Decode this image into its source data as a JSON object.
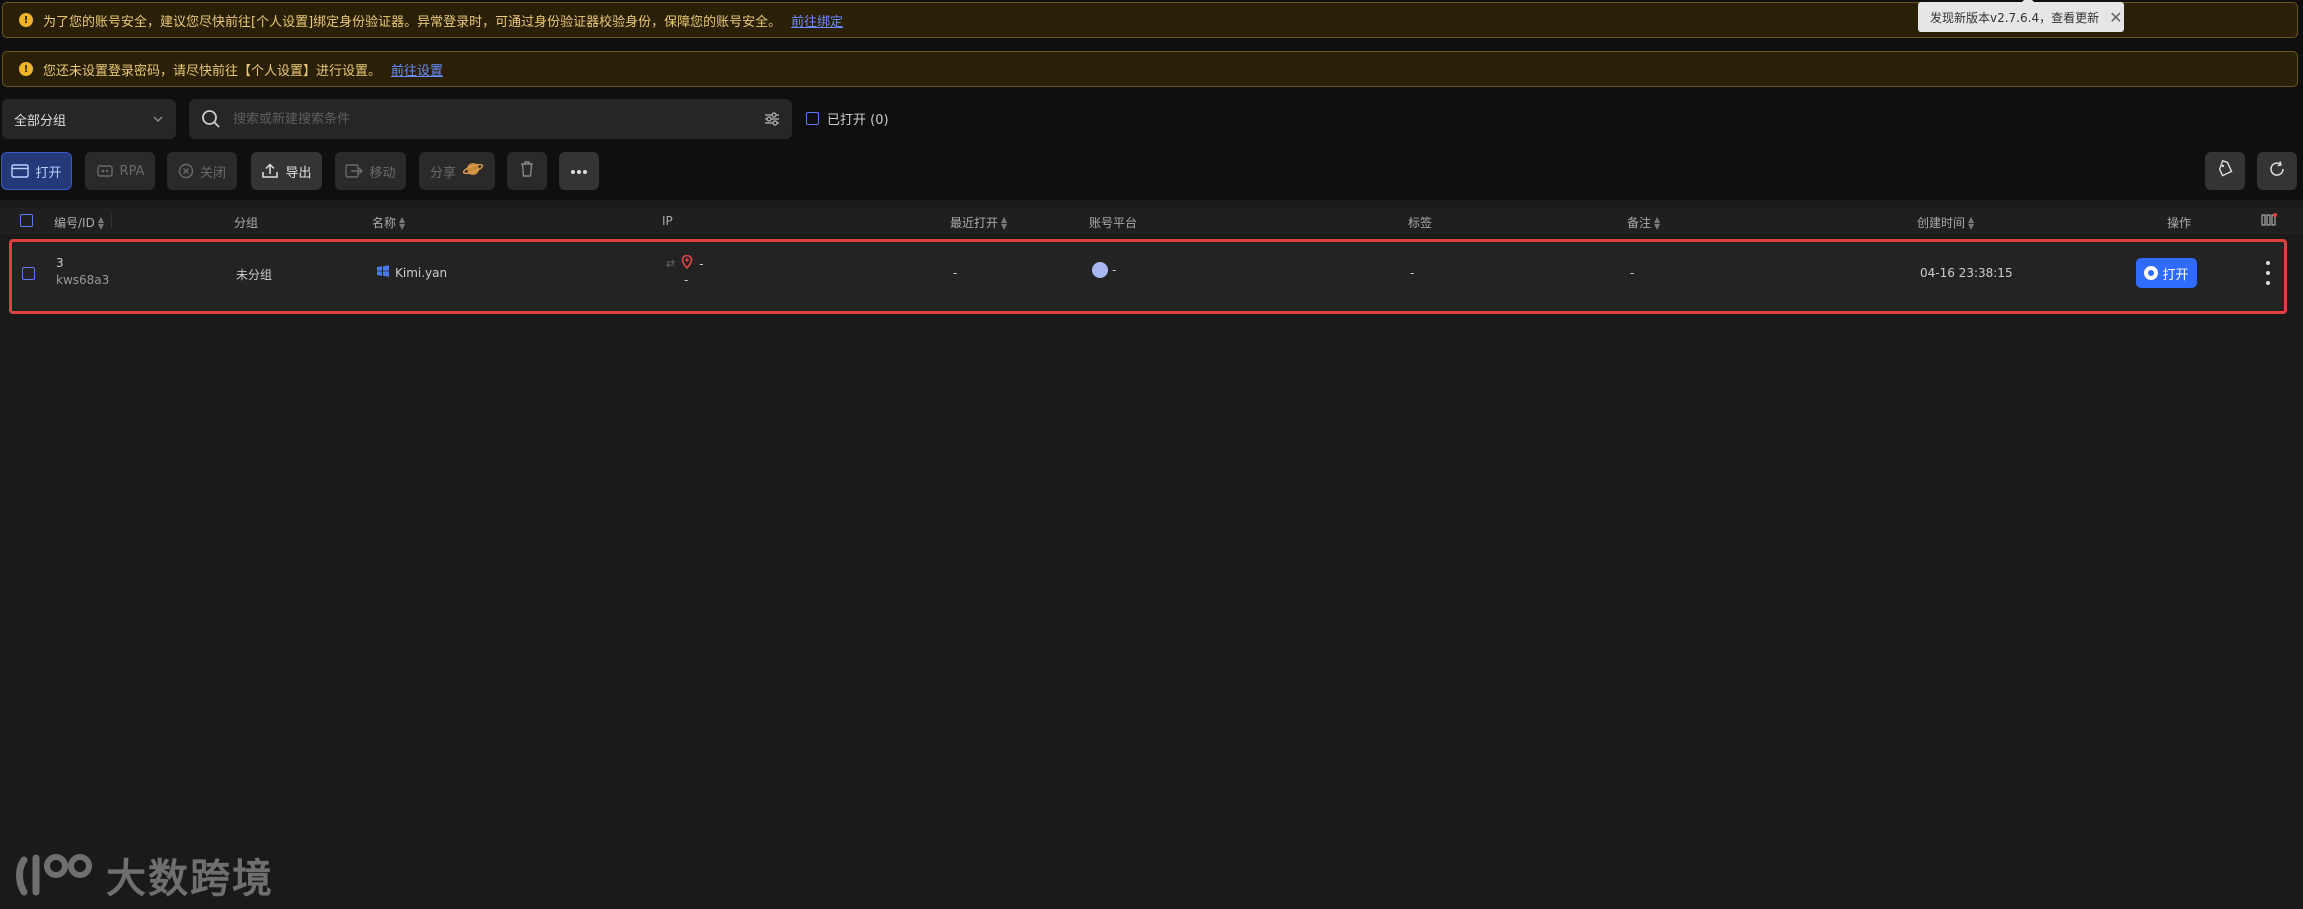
{
  "banners": {
    "security": {
      "text": "为了您的账号安全，建议您尽快前往[个人设置]绑定身份验证器。异常登录时，可通过身份验证器校验身份，保障您的账号安全。",
      "link": "前往绑定"
    },
    "password": {
      "text": "您还未设置登录密码，请尽快前往【个人设置】进行设置。",
      "link": "前往设置"
    }
  },
  "update_toast": {
    "text": "发现新版本v2.7.6.4，查看更新"
  },
  "filters": {
    "group_select": "全部分组",
    "search_placeholder": "搜索或新建搜索条件",
    "opened_label": "已打开 (0)"
  },
  "toolbar": {
    "open": "打开",
    "rpa": "RPA",
    "close": "关闭",
    "export": "导出",
    "move": "移动",
    "share": "分享"
  },
  "table": {
    "columns": {
      "id": "编号/ID",
      "group": "分组",
      "name": "名称",
      "ip": "IP",
      "last_opened": "最近打开",
      "platform": "账号平台",
      "tags": "标签",
      "remark": "备注",
      "created": "创建时间",
      "actions": "操作"
    },
    "rows": [
      {
        "number": "3",
        "id": "kws68a3",
        "group": "未分组",
        "name": "Kimi.yan",
        "ip_main": "-",
        "ip_sub": "-",
        "last_opened": "-",
        "platform": "-",
        "tags": "-",
        "remark": "-",
        "created": "04-16 23:38:15",
        "open_label": "打开"
      }
    ]
  },
  "watermark": {
    "text": "大数跨境"
  },
  "colors": {
    "accent": "#2f6bff",
    "banner_bg": "#2a2008",
    "banner_text": "#e8c877",
    "highlight": "#e04040"
  }
}
